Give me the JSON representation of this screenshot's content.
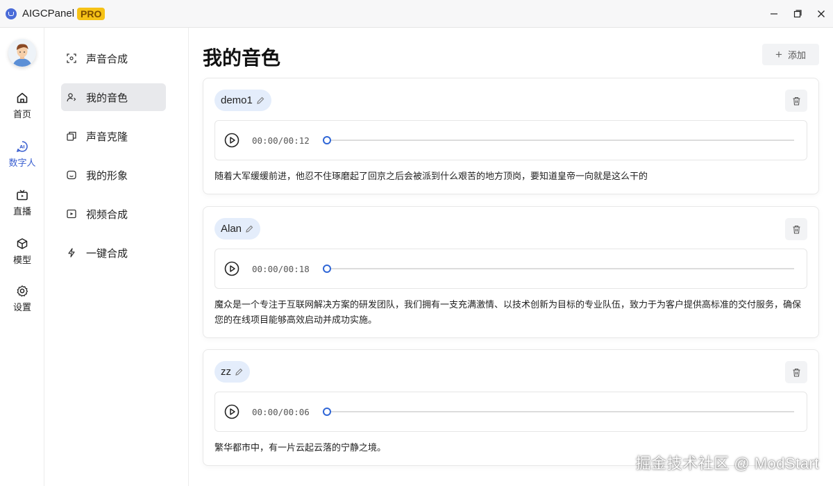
{
  "app": {
    "title": "AIGCPanel",
    "badge": "PRO"
  },
  "window_controls": [
    "minimize-icon",
    "maximize-icon",
    "close-icon"
  ],
  "icon_nav": [
    {
      "label": "首页",
      "icon": "home-icon"
    },
    {
      "label": "数字人",
      "icon": "ai-icon",
      "active": true
    },
    {
      "label": "直播",
      "icon": "tv-icon"
    },
    {
      "label": "模型",
      "icon": "cube-icon"
    },
    {
      "label": "设置",
      "icon": "gear-icon"
    }
  ],
  "sub_nav": [
    {
      "label": "声音合成",
      "icon": "scan-icon"
    },
    {
      "label": "我的音色",
      "icon": "user-voice-icon",
      "active": true
    },
    {
      "label": "声音克隆",
      "icon": "clone-icon"
    },
    {
      "label": "我的形象",
      "icon": "face-icon"
    },
    {
      "label": "视频合成",
      "icon": "video-icon"
    },
    {
      "label": "一键合成",
      "icon": "bolt-icon"
    }
  ],
  "main": {
    "title": "我的音色",
    "add_label": "添加",
    "voices": [
      {
        "name": "demo1",
        "time": "00:00/00:12",
        "progress": 0,
        "text": "随着大军缓缓前进，他忍不住琢磨起了回京之后会被派到什么艰苦的地方顶岗，要知道皇帝一向就是这么干的"
      },
      {
        "name": "Alan",
        "time": "00:00/00:18",
        "progress": 0,
        "text": "魔众是一个专注于互联网解决方案的研发团队，我们拥有一支充满激情、以技术创新为目标的专业队伍，致力于为客户提供高标准的交付服务，确保您的在线项目能够高效启动并成功实施。"
      },
      {
        "name": "zz",
        "time": "00:00/00:06",
        "progress": 0,
        "text": "繁华都市中，有一片云起云落的宁静之境。"
      }
    ]
  },
  "watermark": "掘金技术社区 @ ModStart",
  "colors": {
    "accent": "#2f66d6",
    "active_nav": "#3a5fd0",
    "tag_bg": "#e4edfb",
    "badge": "#f6c216"
  }
}
